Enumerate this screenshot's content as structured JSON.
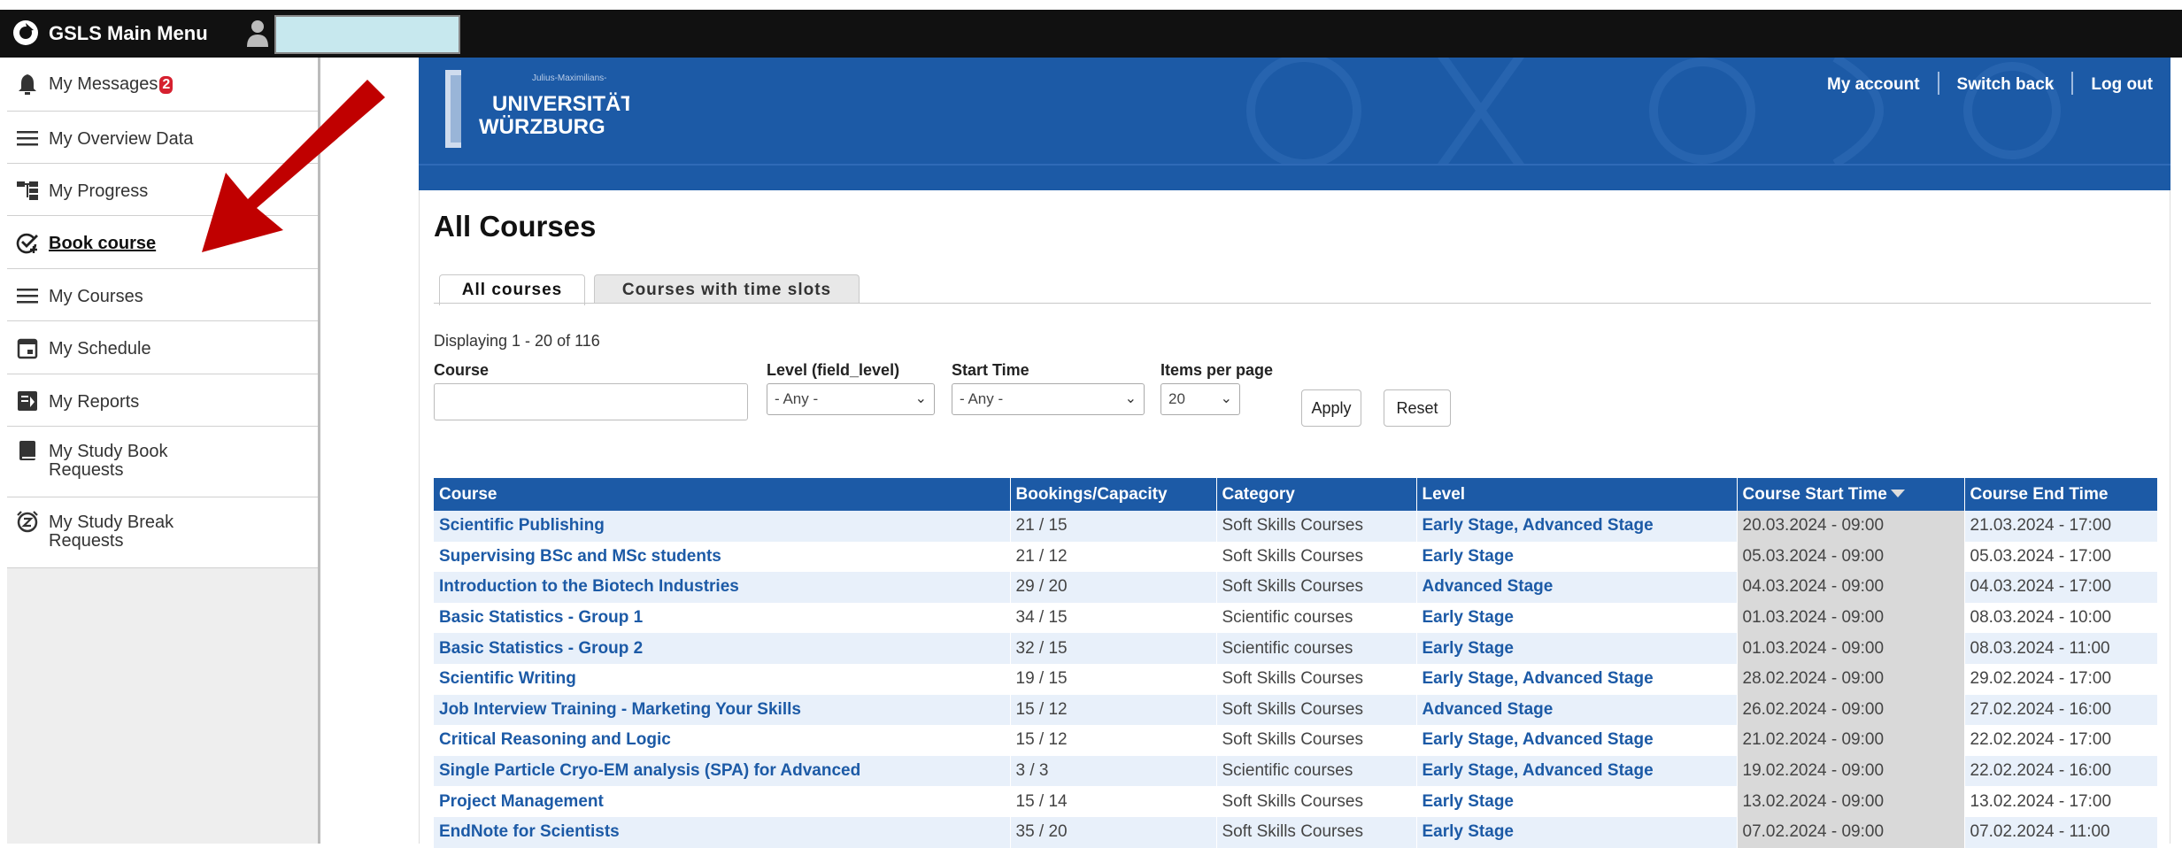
{
  "topbar": {
    "title": "GSLS Main Menu"
  },
  "sidebar": {
    "items": [
      {
        "label": "My Messages",
        "badge": "2",
        "icon": "bell-icon"
      },
      {
        "label": "My Overview Data",
        "icon": "menu-icon"
      },
      {
        "label": "My Progress",
        "icon": "hierarchy-icon"
      },
      {
        "label": "Book course",
        "icon": "check-plus-icon"
      },
      {
        "label": "My Courses",
        "icon": "menu-icon"
      },
      {
        "label": "My Schedule",
        "icon": "calendar-icon"
      },
      {
        "label": "My Reports",
        "icon": "report-icon"
      },
      {
        "label": "My Study Book",
        "label2": "Requests",
        "icon": "book-icon"
      },
      {
        "label": "My Study Break",
        "label2": "Requests",
        "icon": "snooze-clock-icon"
      }
    ]
  },
  "header": {
    "logo_small": "Julius-Maximilians-",
    "logo_line1": "UNIVERSITÄT",
    "logo_line2": "WÜRZBURG",
    "links": {
      "account": "My account",
      "switch": "Switch back",
      "logout": "Log out"
    }
  },
  "main": {
    "title": "All Courses",
    "tabs": [
      {
        "label": "All courses"
      },
      {
        "label": "Courses with time slots"
      }
    ],
    "displaying": "Displaying 1 - 20 of 116",
    "filters": {
      "course_label": "Course",
      "course_value": "",
      "level_label": "Level (field_level)",
      "level_value": "- Any -",
      "start_label": "Start Time",
      "start_value": "- Any -",
      "items_label": "Items per page",
      "items_value": "20",
      "apply": "Apply",
      "reset": "Reset"
    },
    "table": {
      "columns": [
        "Course",
        "Bookings/Capacity",
        "Category",
        "Level",
        "Course Start Time",
        "Course End Time"
      ],
      "rows": [
        [
          "Scientific Publishing",
          "21 / 15",
          "Soft Skills Courses",
          "Early Stage, Advanced Stage",
          "20.03.2024 - 09:00",
          "21.03.2024 - 17:00"
        ],
        [
          "Supervising BSc and MSc students",
          "21 / 12",
          "Soft Skills Courses",
          "Early Stage",
          "05.03.2024 - 09:00",
          "05.03.2024 - 17:00"
        ],
        [
          "Introduction to the Biotech Industries",
          "29 / 20",
          "Soft Skills Courses",
          "Advanced Stage",
          "04.03.2024 - 09:00",
          "04.03.2024 - 17:00"
        ],
        [
          "Basic Statistics - Group 1",
          "34 / 15",
          "Scientific courses",
          "Early Stage",
          "01.03.2024 - 09:00",
          "08.03.2024 - 10:00"
        ],
        [
          "Basic Statistics - Group 2",
          "32 / 15",
          "Scientific courses",
          "Early Stage",
          "01.03.2024 - 09:00",
          "08.03.2024 - 11:00"
        ],
        [
          "Scientific Writing",
          "19 / 15",
          "Soft Skills Courses",
          "Early Stage, Advanced Stage",
          "28.02.2024 - 09:00",
          "29.02.2024 - 17:00"
        ],
        [
          "Job Interview Training - Marketing Your Skills",
          "15 / 12",
          "Soft Skills Courses",
          "Advanced Stage",
          "26.02.2024 - 09:00",
          "27.02.2024 - 16:00"
        ],
        [
          "Critical Reasoning and Logic",
          "15 / 12",
          "Soft Skills Courses",
          "Early Stage, Advanced Stage",
          "21.02.2024 - 09:00",
          "22.02.2024 - 17:00"
        ],
        [
          "Single Particle Cryo-EM analysis (SPA) for Advanced",
          "3 / 3",
          "Scientific courses",
          "Early Stage, Advanced Stage",
          "19.02.2024 - 09:00",
          "22.02.2024 - 16:00"
        ],
        [
          "Project Management",
          "15 / 14",
          "Soft Skills Courses",
          "Early Stage",
          "13.02.2024 - 09:00",
          "13.02.2024 - 17:00"
        ],
        [
          "EndNote for Scientists",
          "35 / 20",
          "Soft Skills Courses",
          "Early Stage",
          "07.02.2024 - 09:00",
          "07.02.2024 - 11:00"
        ]
      ]
    }
  },
  "colors": {
    "brand_blue": "#1c5aa6",
    "arrow_red": "#c00000",
    "badge_red": "#d6202f"
  }
}
